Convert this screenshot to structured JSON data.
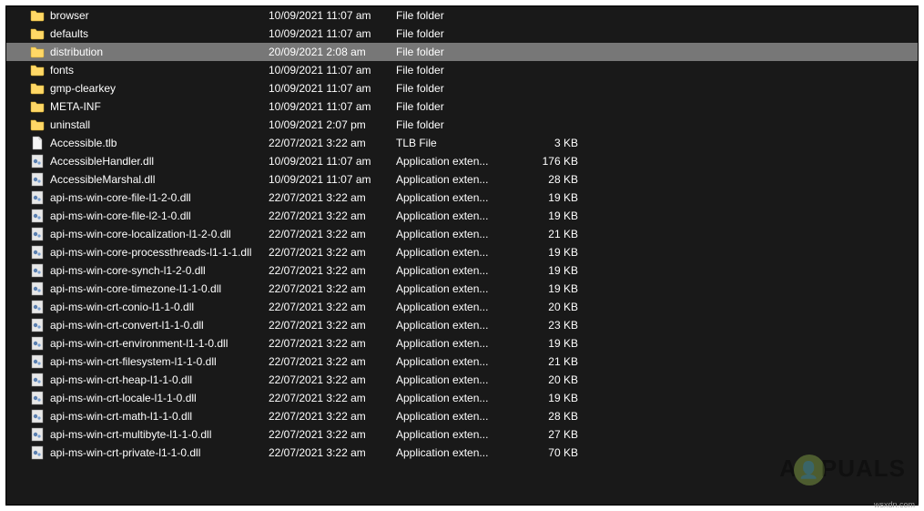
{
  "icons": {
    "folder": "folder",
    "file": "file",
    "dll": "dll"
  },
  "watermark": {
    "prefix": "A",
    "suffix": "PUALS"
  },
  "footer_text": "wsxdn.com",
  "rows": [
    {
      "icon": "folder",
      "name": "browser",
      "date": "10/09/2021 11:07 am",
      "type": "File folder",
      "size": "",
      "selected": false
    },
    {
      "icon": "folder",
      "name": "defaults",
      "date": "10/09/2021 11:07 am",
      "type": "File folder",
      "size": "",
      "selected": false
    },
    {
      "icon": "folder",
      "name": "distribution",
      "date": "20/09/2021 2:08 am",
      "type": "File folder",
      "size": "",
      "selected": true
    },
    {
      "icon": "folder",
      "name": "fonts",
      "date": "10/09/2021 11:07 am",
      "type": "File folder",
      "size": "",
      "selected": false
    },
    {
      "icon": "folder",
      "name": "gmp-clearkey",
      "date": "10/09/2021 11:07 am",
      "type": "File folder",
      "size": "",
      "selected": false
    },
    {
      "icon": "folder",
      "name": "META-INF",
      "date": "10/09/2021 11:07 am",
      "type": "File folder",
      "size": "",
      "selected": false
    },
    {
      "icon": "folder",
      "name": "uninstall",
      "date": "10/09/2021 2:07 pm",
      "type": "File folder",
      "size": "",
      "selected": false
    },
    {
      "icon": "file",
      "name": "Accessible.tlb",
      "date": "22/07/2021 3:22 am",
      "type": "TLB File",
      "size": "3 KB",
      "selected": false
    },
    {
      "icon": "dll",
      "name": "AccessibleHandler.dll",
      "date": "10/09/2021 11:07 am",
      "type": "Application exten...",
      "size": "176 KB",
      "selected": false
    },
    {
      "icon": "dll",
      "name": "AccessibleMarshal.dll",
      "date": "10/09/2021 11:07 am",
      "type": "Application exten...",
      "size": "28 KB",
      "selected": false
    },
    {
      "icon": "dll",
      "name": "api-ms-win-core-file-l1-2-0.dll",
      "date": "22/07/2021 3:22 am",
      "type": "Application exten...",
      "size": "19 KB",
      "selected": false
    },
    {
      "icon": "dll",
      "name": "api-ms-win-core-file-l2-1-0.dll",
      "date": "22/07/2021 3:22 am",
      "type": "Application exten...",
      "size": "19 KB",
      "selected": false
    },
    {
      "icon": "dll",
      "name": "api-ms-win-core-localization-l1-2-0.dll",
      "date": "22/07/2021 3:22 am",
      "type": "Application exten...",
      "size": "21 KB",
      "selected": false
    },
    {
      "icon": "dll",
      "name": "api-ms-win-core-processthreads-l1-1-1.dll",
      "date": "22/07/2021 3:22 am",
      "type": "Application exten...",
      "size": "19 KB",
      "selected": false
    },
    {
      "icon": "dll",
      "name": "api-ms-win-core-synch-l1-2-0.dll",
      "date": "22/07/2021 3:22 am",
      "type": "Application exten...",
      "size": "19 KB",
      "selected": false
    },
    {
      "icon": "dll",
      "name": "api-ms-win-core-timezone-l1-1-0.dll",
      "date": "22/07/2021 3:22 am",
      "type": "Application exten...",
      "size": "19 KB",
      "selected": false
    },
    {
      "icon": "dll",
      "name": "api-ms-win-crt-conio-l1-1-0.dll",
      "date": "22/07/2021 3:22 am",
      "type": "Application exten...",
      "size": "20 KB",
      "selected": false
    },
    {
      "icon": "dll",
      "name": "api-ms-win-crt-convert-l1-1-0.dll",
      "date": "22/07/2021 3:22 am",
      "type": "Application exten...",
      "size": "23 KB",
      "selected": false
    },
    {
      "icon": "dll",
      "name": "api-ms-win-crt-environment-l1-1-0.dll",
      "date": "22/07/2021 3:22 am",
      "type": "Application exten...",
      "size": "19 KB",
      "selected": false
    },
    {
      "icon": "dll",
      "name": "api-ms-win-crt-filesystem-l1-1-0.dll",
      "date": "22/07/2021 3:22 am",
      "type": "Application exten...",
      "size": "21 KB",
      "selected": false
    },
    {
      "icon": "dll",
      "name": "api-ms-win-crt-heap-l1-1-0.dll",
      "date": "22/07/2021 3:22 am",
      "type": "Application exten...",
      "size": "20 KB",
      "selected": false
    },
    {
      "icon": "dll",
      "name": "api-ms-win-crt-locale-l1-1-0.dll",
      "date": "22/07/2021 3:22 am",
      "type": "Application exten...",
      "size": "19 KB",
      "selected": false
    },
    {
      "icon": "dll",
      "name": "api-ms-win-crt-math-l1-1-0.dll",
      "date": "22/07/2021 3:22 am",
      "type": "Application exten...",
      "size": "28 KB",
      "selected": false
    },
    {
      "icon": "dll",
      "name": "api-ms-win-crt-multibyte-l1-1-0.dll",
      "date": "22/07/2021 3:22 am",
      "type": "Application exten...",
      "size": "27 KB",
      "selected": false
    },
    {
      "icon": "dll",
      "name": "api-ms-win-crt-private-l1-1-0.dll",
      "date": "22/07/2021 3:22 am",
      "type": "Application exten...",
      "size": "70 KB",
      "selected": false
    }
  ]
}
